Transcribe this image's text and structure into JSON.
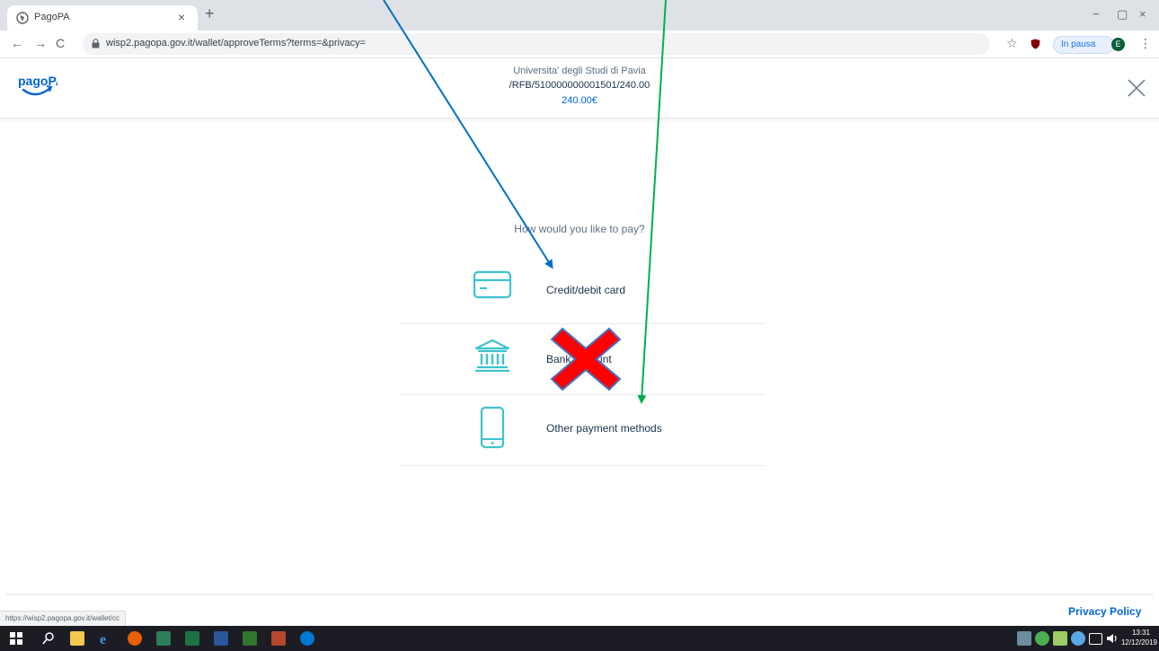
{
  "browser": {
    "tab_title": "PagoPA",
    "tab_close": "×",
    "new_tab": "+",
    "url": "wisp2.pagopa.gov.it/wallet/approveTerms?terms=&privacy=",
    "profile_status": "In pausa",
    "profile_initial": "E",
    "window_minimize": "−",
    "window_maximize": "▢",
    "window_close": "×",
    "back": "←",
    "forward": "→",
    "reload": "C",
    "star": "☆",
    "menu": "⋮"
  },
  "header": {
    "logo_text": "pagoPA",
    "payee_name": "Universita' degli Studi di Pavia",
    "payment_reference": "/RFB/51000000000150​1/240.00",
    "amount": "240.00€"
  },
  "main": {
    "question": "How would you like to pay?",
    "options": [
      {
        "label": "Credit/debit card",
        "icon": "credit-card-icon"
      },
      {
        "label": "Bank account",
        "icon": "bank-icon"
      },
      {
        "label": "Other payment methods",
        "icon": "smartphone-icon"
      }
    ]
  },
  "footer": {
    "privacy_link": "Privacy Policy",
    "status_url": "https://wisp2.pagopa.gov.it/wallet/cc"
  },
  "taskbar": {
    "time": "13:31",
    "date": "12/12/2019"
  },
  "colors": {
    "brand": "#0066cc",
    "icon_teal": "#3ec2cf",
    "arrow_blue": "#0070c0",
    "arrow_green": "#00b050",
    "cross_red": "#ff0000",
    "cross_outline": "#4472c4"
  }
}
